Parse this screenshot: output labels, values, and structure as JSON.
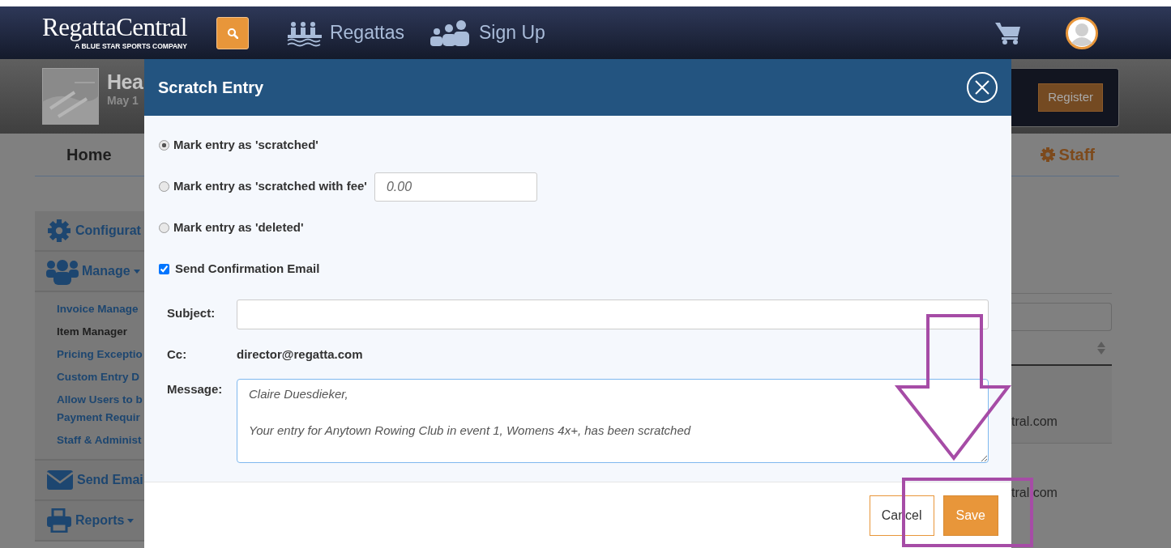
{
  "navbar": {
    "logo": "RegattaCentral",
    "tagline": "A BLUE STAR SPORTS COMPANY",
    "links": [
      {
        "label": "Regattas",
        "kind": "regattas"
      },
      {
        "label": "Sign Up",
        "kind": "signup"
      }
    ]
  },
  "regatta_header": {
    "title": "Hea",
    "date": "May 1",
    "register_button": "Register"
  },
  "tabs": [
    {
      "label": "Home",
      "kind": "home"
    },
    {
      "label": "Staff",
      "kind": "staff"
    }
  ],
  "sidebar": {
    "sections": [
      {
        "label": "Configurat",
        "kind": "gear",
        "dropdown": false
      },
      {
        "label": "Manage",
        "kind": "people",
        "dropdown": true,
        "children": [
          {
            "label": "Invoice Manage",
            "selected": false
          },
          {
            "label": "Item Manager",
            "selected": true
          },
          {
            "label": "Pricing Exceptio",
            "selected": false
          },
          {
            "label": "Custom Entry D",
            "selected": false
          },
          {
            "label": "Allow Users to b Payment Requir",
            "selected": false
          },
          {
            "label": "Staff & Administ",
            "selected": false
          }
        ]
      },
      {
        "label": "Send Emai",
        "kind": "mail",
        "dropdown": false
      },
      {
        "label": "Reports",
        "kind": "printer",
        "dropdown": true
      }
    ]
  },
  "background_table": {
    "cells": [
      "tral.com",
      "tral.com"
    ]
  },
  "modal": {
    "title": "Scratch Entry",
    "options": [
      {
        "label": "Mark entry as 'scratched'",
        "selected": true
      },
      {
        "label": "Mark entry as 'scratched with fee'",
        "selected": false,
        "fee_placeholder": "0.00"
      },
      {
        "label": "Mark entry as 'deleted'",
        "selected": false
      }
    ],
    "send_email": {
      "label": "Send Confirmation Email",
      "checked": true
    },
    "subject_label": "Subject:",
    "cc_label": "Cc:",
    "cc_value": "director@regatta.com",
    "message_label": "Message:",
    "message_value": "Claire Duesdieker,\n\nYour entry for Anytown Rowing Club in event 1, Womens 4x+, has been scratched",
    "buttons": [
      {
        "label": "Cancel",
        "kind": "secondary"
      },
      {
        "label": "Save",
        "kind": "primary"
      }
    ]
  }
}
